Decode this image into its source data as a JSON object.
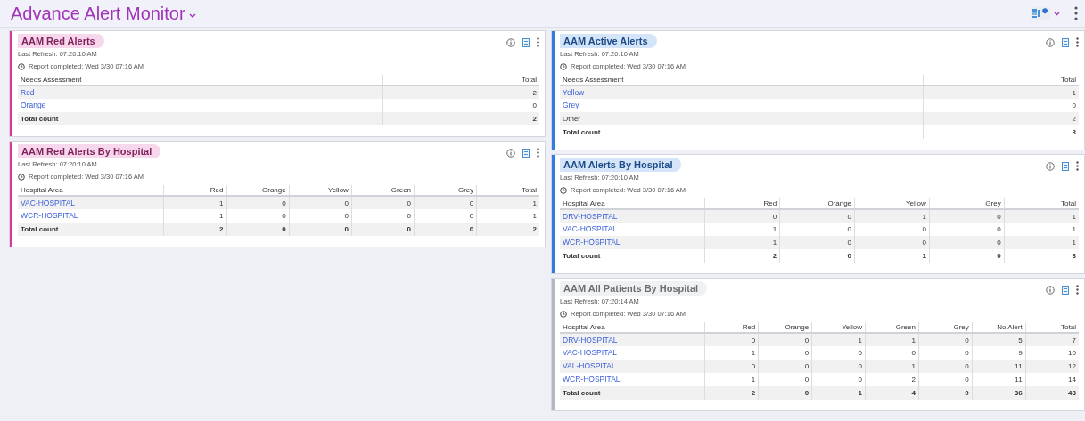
{
  "page": {
    "title": "Advance Alert Monitor"
  },
  "columns": [
    {
      "panels": [
        {
          "title": "AAM Red Alerts",
          "color": "#d6399a",
          "last_refresh": "Last Refresh: 07:20:10 AM",
          "report": "Report completed: Wed 3/30 07:16 AM",
          "headers": [
            "Needs Assessment",
            "Total"
          ],
          "rows": [
            {
              "kind": "link",
              "cells": [
                "Red",
                "2"
              ]
            },
            {
              "kind": "link",
              "cells": [
                "Orange",
                "0"
              ]
            },
            {
              "kind": "total",
              "cells": [
                "Total count",
                "2"
              ]
            }
          ]
        },
        {
          "title": "AAM Red Alerts By Hospital",
          "color": "#d6399a",
          "last_refresh": "Last Refresh: 07:20:10 AM",
          "report": "Report completed: Wed 3/30 07:16 AM",
          "headers": [
            "Hospital Area",
            "Red",
            "Orange",
            "Yellow",
            "Green",
            "Grey",
            "Total"
          ],
          "rows": [
            {
              "kind": "link",
              "cells": [
                "VAC-HOSPITAL",
                "1",
                "0",
                "0",
                "0",
                "0",
                "1"
              ]
            },
            {
              "kind": "link",
              "cells": [
                "WCR-HOSPITAL",
                "1",
                "0",
                "0",
                "0",
                "0",
                "1"
              ]
            },
            {
              "kind": "total",
              "cells": [
                "Total count",
                "2",
                "0",
                "0",
                "0",
                "0",
                "2"
              ]
            }
          ]
        }
      ]
    },
    {
      "panels": [
        {
          "title": "AAM Active Alerts",
          "color": "#2f7de1",
          "last_refresh": "Last Refresh: 07:20:10 AM",
          "report": "Report completed: Wed 3/30 07:16 AM",
          "headers": [
            "Needs Assessment",
            "Total"
          ],
          "rows": [
            {
              "kind": "link",
              "cells": [
                "Yellow",
                "1"
              ]
            },
            {
              "kind": "link",
              "cells": [
                "Grey",
                "0"
              ]
            },
            {
              "kind": "plain",
              "cells": [
                "Other",
                "2"
              ]
            },
            {
              "kind": "total",
              "cells": [
                "Total count",
                "3"
              ]
            }
          ]
        },
        {
          "title": "AAM Alerts By Hospital",
          "color": "#2f7de1",
          "last_refresh": "Last Refresh: 07:20:10 AM",
          "report": "Report completed: Wed 3/30 07:16 AM",
          "headers": [
            "Hospital Area",
            "Red",
            "Orange",
            "Yellow",
            "Grey",
            "Total"
          ],
          "rows": [
            {
              "kind": "link",
              "cells": [
                "DRV-HOSPITAL",
                "0",
                "0",
                "1",
                "0",
                "1"
              ]
            },
            {
              "kind": "link",
              "cells": [
                "VAC-HOSPITAL",
                "1",
                "0",
                "0",
                "0",
                "1"
              ]
            },
            {
              "kind": "link",
              "cells": [
                "WCR-HOSPITAL",
                "1",
                "0",
                "0",
                "0",
                "1"
              ]
            },
            {
              "kind": "total",
              "cells": [
                "Total count",
                "2",
                "0",
                "1",
                "0",
                "3"
              ]
            }
          ]
        },
        {
          "title": "AAM All Patients By Hospital",
          "color": "#b4b8bf",
          "last_refresh": "Last Refresh: 07:20:14 AM",
          "report": "Report completed: Wed 3/30 07:16 AM",
          "headers": [
            "Hospital Area",
            "Red",
            "Orange",
            "Yellow",
            "Green",
            "Grey",
            "No Alert",
            "Total"
          ],
          "rows": [
            {
              "kind": "link",
              "cells": [
                "DRV-HOSPITAL",
                "0",
                "0",
                "1",
                "1",
                "0",
                "5",
                "7"
              ]
            },
            {
              "kind": "link",
              "cells": [
                "VAC-HOSPITAL",
                "1",
                "0",
                "0",
                "0",
                "0",
                "9",
                "10"
              ]
            },
            {
              "kind": "link",
              "cells": [
                "VAL-HOSPITAL",
                "0",
                "0",
                "0",
                "1",
                "0",
                "11",
                "12"
              ]
            },
            {
              "kind": "link",
              "cells": [
                "WCR-HOSPITAL",
                "1",
                "0",
                "0",
                "2",
                "0",
                "11",
                "14"
              ]
            },
            {
              "kind": "total",
              "cells": [
                "Total count",
                "2",
                "0",
                "1",
                "4",
                "0",
                "36",
                "43"
              ]
            }
          ]
        }
      ]
    }
  ]
}
